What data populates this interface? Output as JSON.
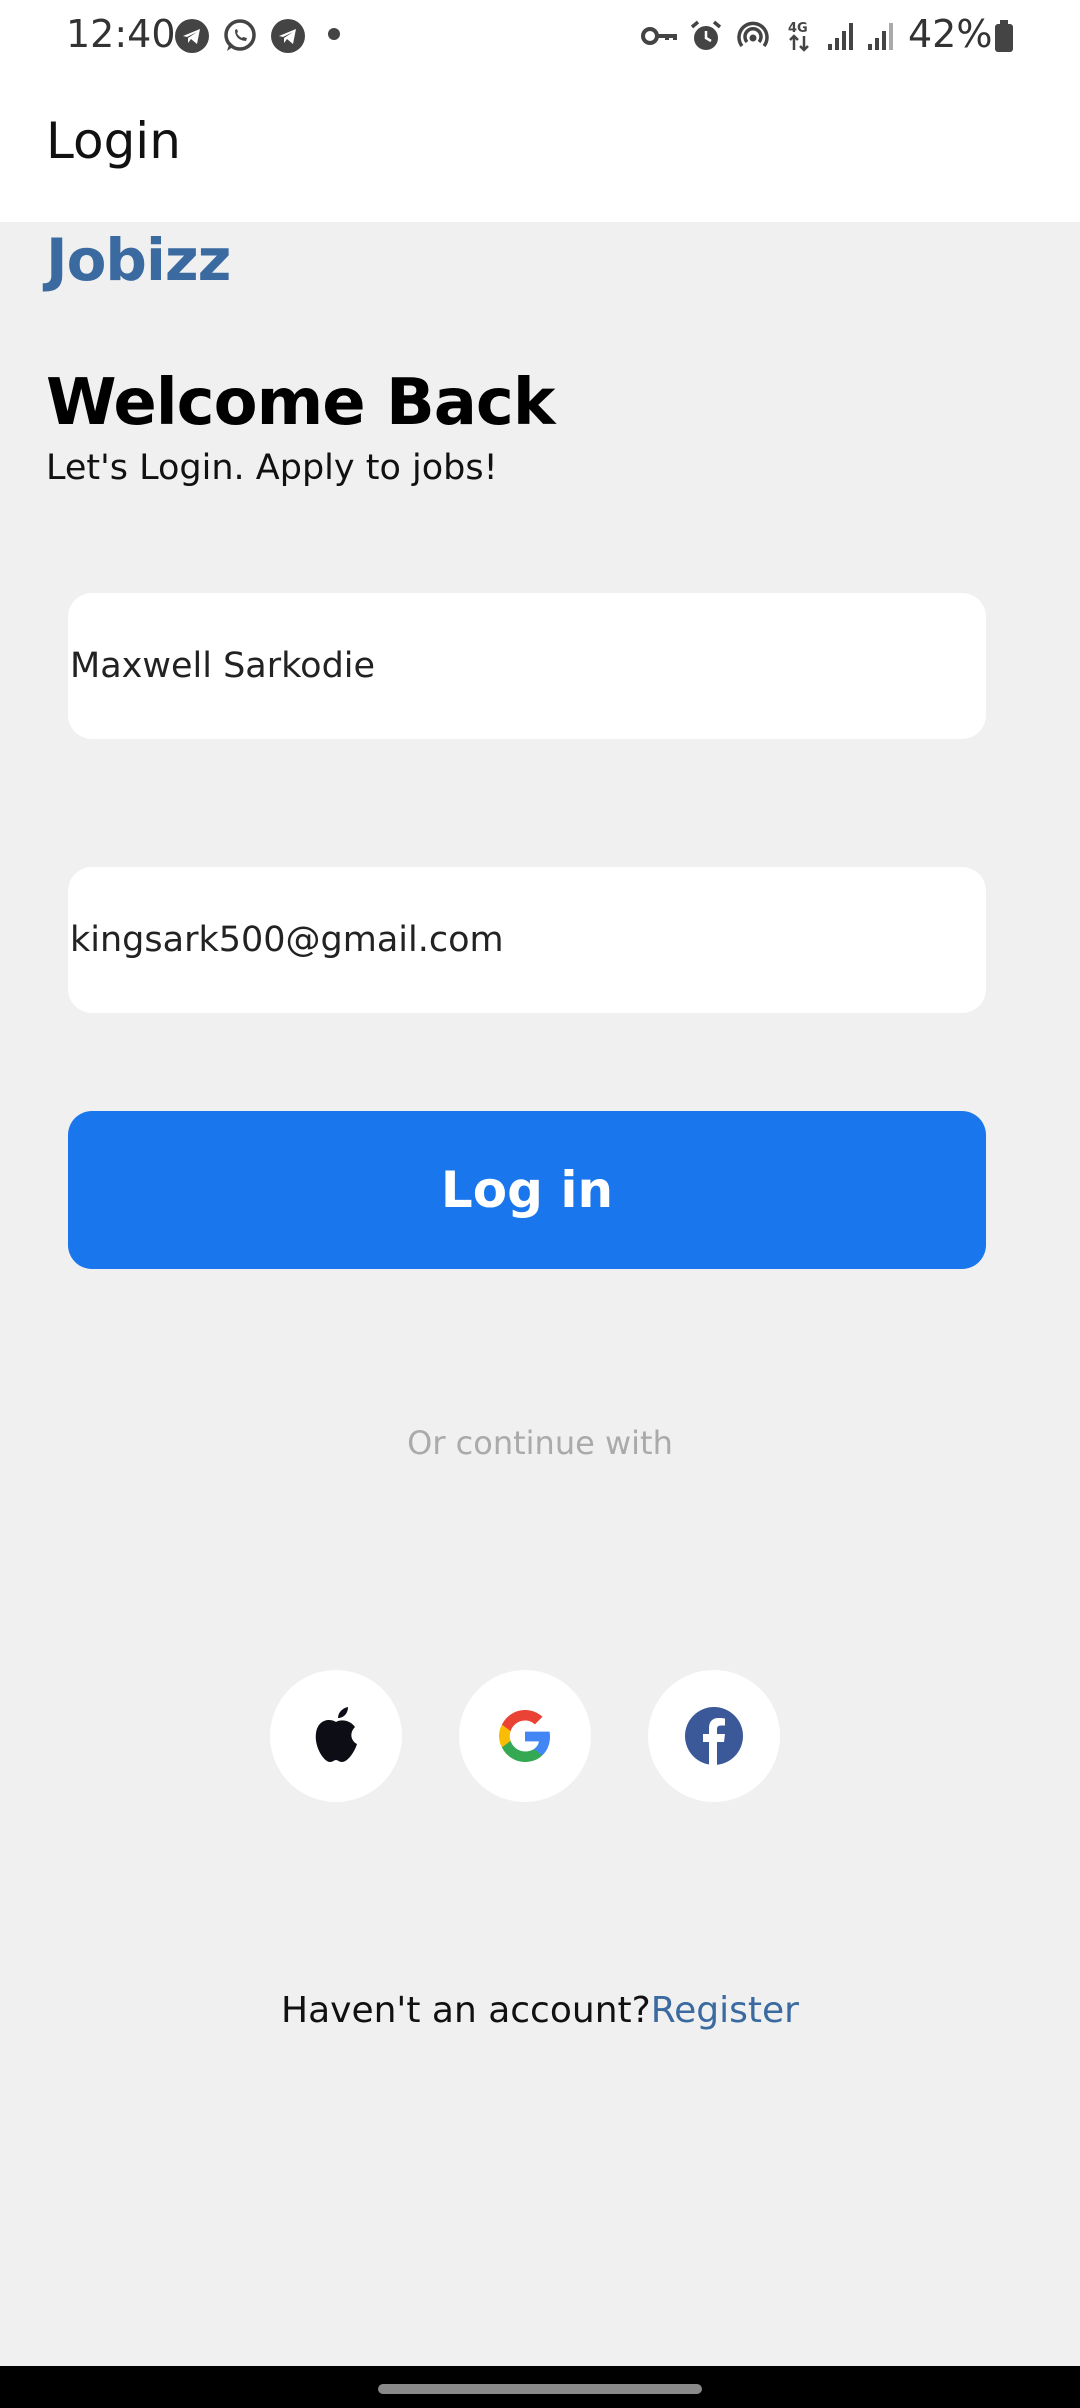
{
  "status_bar": {
    "time": "12:40",
    "battery": "42%",
    "icons": [
      "telegram-icon",
      "whatsapp-icon",
      "telegram-icon",
      "vpn-key-icon",
      "alarm-icon",
      "hotspot-icon",
      "4g-icon",
      "signal-icon",
      "signal-icon",
      "battery-icon"
    ]
  },
  "app_bar": {
    "title": "Login"
  },
  "brand": "Jobizz",
  "welcome": {
    "title": "Welcome Back",
    "subtitle": "Let's Login. Apply to jobs!"
  },
  "form": {
    "name_value": "Maxwell Sarkodie",
    "email_value": "kingsark500@gmail.com",
    "login_label": "Log in"
  },
  "or_text": "Or continue with",
  "social": [
    "apple-icon",
    "google-icon",
    "facebook-icon"
  ],
  "register": {
    "prompt": "Haven't an account?",
    "link": "Register"
  },
  "colors": {
    "accent": "#1a76ec",
    "brand": "#3a6aa0",
    "background": "#f0f0f0"
  }
}
